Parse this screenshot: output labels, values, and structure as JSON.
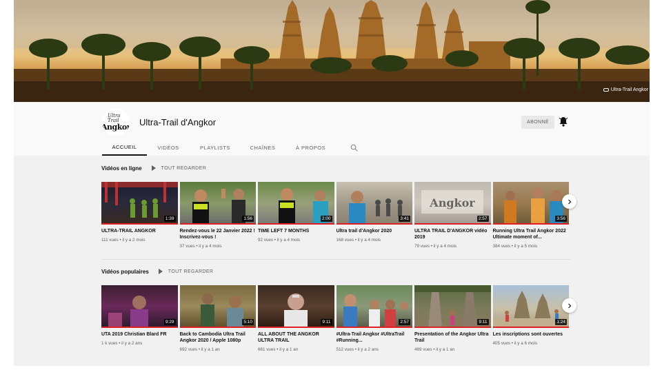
{
  "banner": {
    "link_label": "Ultra-Trail Angkor",
    "link_icon": "link-icon"
  },
  "channel": {
    "name": "Ultra-Trail d'Angkor",
    "avatar_line1": "Ultra Trail",
    "avatar_line2": "Angkor",
    "subscribe_label": "ABONNÉ",
    "bell_icon": "bell-icon"
  },
  "tabs": [
    "ACCUEIL",
    "VIDÉOS",
    "PLAYLISTS",
    "CHAÎNES",
    "À PROPOS"
  ],
  "search_icon": "search-icon",
  "sections": [
    {
      "title": "Vidéos en ligne",
      "play_all": "TOUT REGARDER",
      "videos": [
        {
          "title": "ULTRA-TRAIL ANGKOR",
          "meta": "111 vues • il y a 2 mois",
          "duration": "1:39"
        },
        {
          "title": "Rendez-vous le 22 Janvier 2022 ! Inscrivez-vous !",
          "meta": "37 vues • il y a 4 mois",
          "duration": "1:56"
        },
        {
          "title": "TIME LEFT 7 MONTHS",
          "meta": "92 vues • il y a 4 mois",
          "duration": "2:00"
        },
        {
          "title": "Ultra trail d'Angkor 2020",
          "meta": "168 vues • il y a 4 mois",
          "duration": "3:41"
        },
        {
          "title": "ULTRA TRAIL D'ANGKOR vidéo 2019",
          "meta": "79 vues • il y a 4 mois",
          "duration": "2:57"
        },
        {
          "title": "Running Ultra Trail Angkor 2022 Ultimate moment of...",
          "meta": "384 vues • il y a 5 mois",
          "duration": "3:56"
        }
      ]
    },
    {
      "title": "Vidéos populaires",
      "play_all": "TOUT REGARDER",
      "videos": [
        {
          "title": "UTA 2019 Christian Blard FR",
          "meta": "1 k vues • il y a 2 ans",
          "duration": "9:29"
        },
        {
          "title": "Back to Cambodia Ultra Trail Angkor 2020 / Apple 1080p",
          "meta": "692 vues • il y a 1 an",
          "duration": "5:10"
        },
        {
          "title": "ALL ABOUT THE ANGKOR ULTRA TRAIL",
          "meta": "661 vues • il y a 1 an",
          "duration": "9:11"
        },
        {
          "title": "#Ultra-Trail Angkor #UltraTrail #Running...",
          "meta": "512 vues • il y a 2 ans",
          "duration": "2:57"
        },
        {
          "title": "Presentation of the Angkor Ultra Trail",
          "meta": "469 vues • il y a 1 an",
          "duration": "9:11"
        },
        {
          "title": "Les inscriptions sont ouvertes",
          "meta": "405 vues • il y a 6 mois",
          "duration": "1:24"
        }
      ]
    }
  ],
  "next_icon": "chevron-right-icon"
}
